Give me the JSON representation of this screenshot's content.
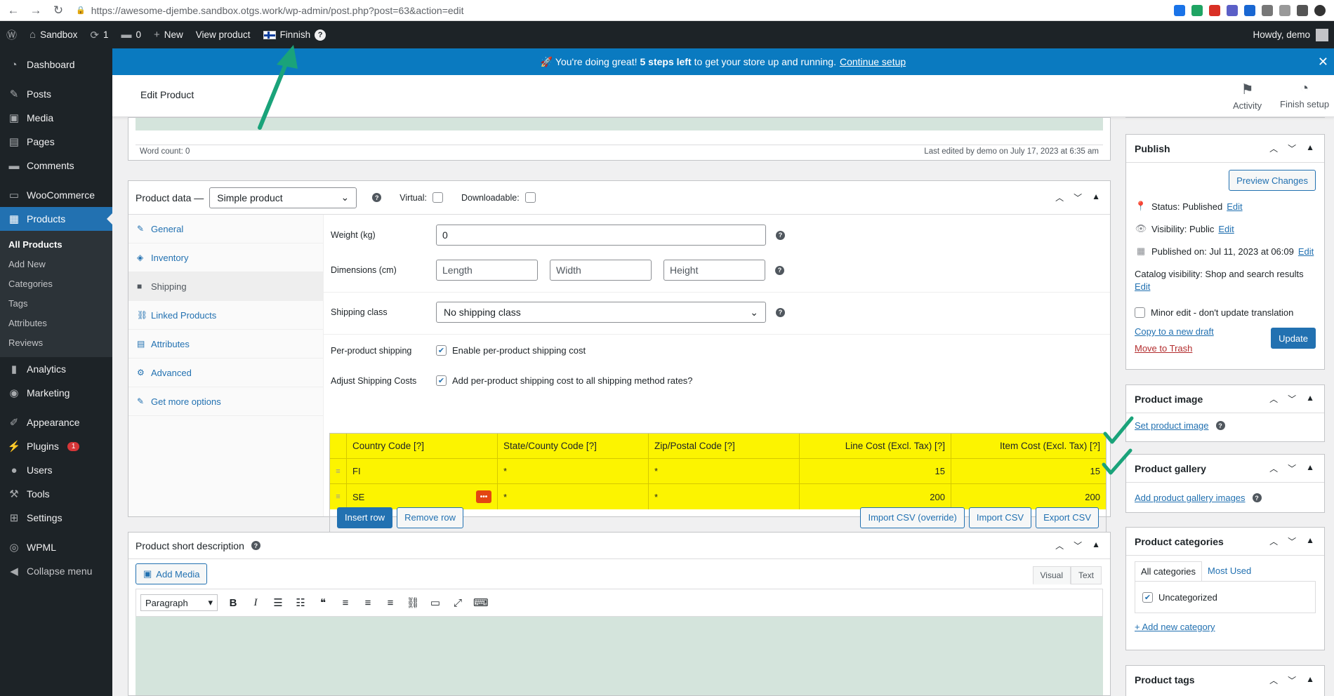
{
  "browser": {
    "url": "https://awesome-djembe.sandbox.otgs.work/wp-admin/post.php?post=63&action=edit"
  },
  "adminbar": {
    "site": "Sandbox",
    "updates": "1",
    "comments": "0",
    "new": "New",
    "view_product": "View product",
    "language": "Finnish",
    "howdy": "Howdy, demo"
  },
  "sidebar": {
    "items": [
      {
        "label": "Dashboard"
      },
      {
        "label": "Posts"
      },
      {
        "label": "Media"
      },
      {
        "label": "Pages"
      },
      {
        "label": "Comments"
      },
      {
        "label": "WooCommerce"
      },
      {
        "label": "Products"
      },
      {
        "label": "Analytics"
      },
      {
        "label": "Marketing"
      },
      {
        "label": "Appearance"
      },
      {
        "label": "Plugins"
      },
      {
        "label": "Users"
      },
      {
        "label": "Tools"
      },
      {
        "label": "Settings"
      },
      {
        "label": "WPML"
      },
      {
        "label": "Collapse menu"
      }
    ],
    "plugins_badge": "1",
    "sub": [
      "All Products",
      "Add New",
      "Categories",
      "Tags",
      "Attributes",
      "Reviews"
    ]
  },
  "notice": {
    "pre": "🚀 You're doing great!",
    "bold": "5 steps left",
    "mid": "to get your store up and running.",
    "link": "Continue setup"
  },
  "header": {
    "title": "Edit Product",
    "activity": "Activity",
    "finish": "Finish setup"
  },
  "editor": {
    "word_count": "Word count: 0",
    "last_edited": "Last edited by demo on July 17, 2023 at 6:35 am"
  },
  "product_data": {
    "title": "Product data —",
    "type": "Simple product",
    "virtual": "Virtual:",
    "downloadable": "Downloadable:",
    "tabs": [
      "General",
      "Inventory",
      "Shipping",
      "Linked Products",
      "Attributes",
      "Advanced",
      "Get more options"
    ],
    "weight_label": "Weight (kg)",
    "weight_value": "0",
    "dimensions_label": "Dimensions (cm)",
    "length_ph": "Length",
    "width_ph": "Width",
    "height_ph": "Height",
    "shipping_class_label": "Shipping class",
    "shipping_class": "No shipping class",
    "per_product_label": "Per-product shipping",
    "per_product_cb": "Enable per-product shipping cost",
    "adjust_label": "Adjust Shipping Costs",
    "adjust_cb": "Add per-product shipping cost to all shipping method rates?",
    "table": {
      "headers": [
        "Country Code [?]",
        "State/County Code [?]",
        "Zip/Postal Code [?]",
        "Line Cost (Excl. Tax) [?]",
        "Item Cost (Excl. Tax) [?]"
      ],
      "rows": [
        [
          "FI",
          "*",
          "*",
          "15",
          "15"
        ],
        [
          "SE",
          "*",
          "*",
          "200",
          "200"
        ]
      ]
    },
    "insert_row": "Insert row",
    "remove_row": "Remove row",
    "import_override": "Import CSV (override)",
    "import_csv": "Import CSV",
    "export_csv": "Export CSV"
  },
  "short_desc": {
    "title": "Product short description",
    "add_media": "Add Media",
    "visual": "Visual",
    "text": "Text",
    "format": "Paragraph"
  },
  "publish": {
    "title": "Publish",
    "preview": "Preview Changes",
    "status": "Status: Published",
    "visibility": "Visibility: Public",
    "published_on": "Published on: Jul 11, 2023 at 06:09",
    "catalog": "Catalog visibility: Shop and search results",
    "edit": "Edit",
    "minor_edit": "Minor edit - don't update translation",
    "copy": "Copy to a new draft",
    "trash": "Move to Trash",
    "update": "Update"
  },
  "product_image": {
    "title": "Product image",
    "link": "Set product image"
  },
  "product_gallery": {
    "title": "Product gallery",
    "link": "Add product gallery images"
  },
  "categories": {
    "title": "Product categories",
    "all": "All categories",
    "most_used": "Most Used",
    "item": "Uncategorized",
    "add": "+ Add new category"
  },
  "tags": {
    "title": "Product tags"
  },
  "colors": {
    "accent": "#2271b1",
    "highlight": "#fcf400",
    "annotation": "#1aa37a",
    "notice": "#0a7ac0"
  }
}
